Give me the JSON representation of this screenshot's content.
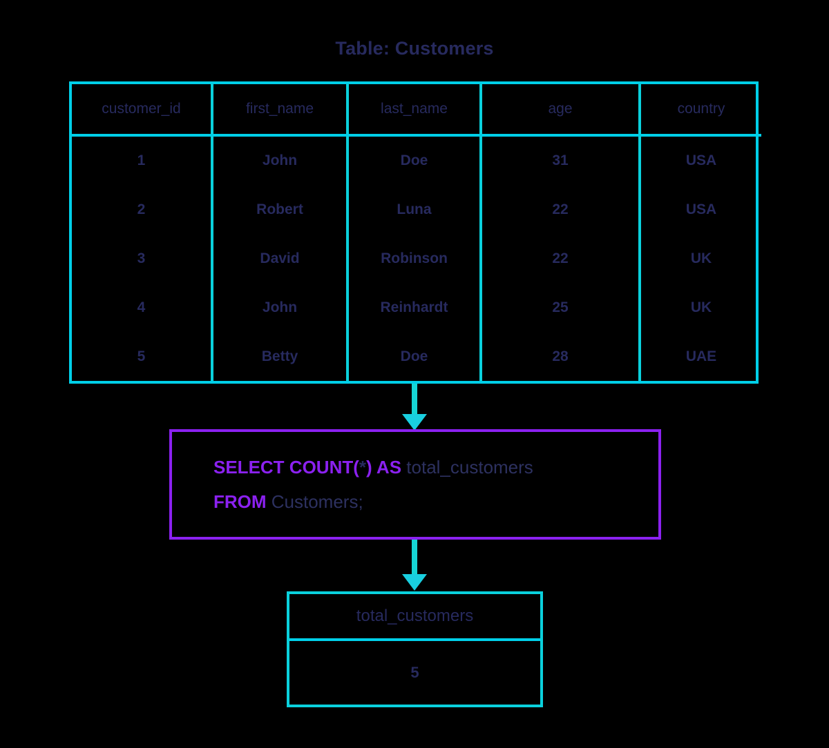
{
  "title": "Table: Customers",
  "colors": {
    "table_border": "#00cfe8",
    "cell_divider": "#0ad1dd",
    "arrow": "#16d6d6",
    "query_border": "#8b21f0",
    "keyword": "#8b21f0",
    "text": "#272a5e",
    "background": "#000000"
  },
  "source_table": {
    "name": "Customers",
    "columns": [
      "customer_id",
      "first_name",
      "last_name",
      "age",
      "country"
    ],
    "rows": [
      {
        "customer_id": "1",
        "first_name": "John",
        "last_name": "Doe",
        "age": "31",
        "country": "USA"
      },
      {
        "customer_id": "2",
        "first_name": "Robert",
        "last_name": "Luna",
        "age": "22",
        "country": "USA"
      },
      {
        "customer_id": "3",
        "first_name": "David",
        "last_name": "Robinson",
        "age": "22",
        "country": "UK"
      },
      {
        "customer_id": "4",
        "first_name": "John",
        "last_name": "Reinhardt",
        "age": "25",
        "country": "UK"
      },
      {
        "customer_id": "5",
        "first_name": "Betty",
        "last_name": "Doe",
        "age": "28",
        "country": "UAE"
      }
    ]
  },
  "query": {
    "line1": {
      "keyword_a": "SELECT COUNT(",
      "star": "*",
      "keyword_b": ") AS ",
      "identifier": "total_customers"
    },
    "line2": {
      "keyword": "FROM ",
      "identifier": "Customers;"
    },
    "full_text": "SELECT COUNT(*) AS total_customers FROM Customers;"
  },
  "result_table": {
    "columns": [
      "total_customers"
    ],
    "rows": [
      {
        "total_customers": "5"
      }
    ]
  }
}
